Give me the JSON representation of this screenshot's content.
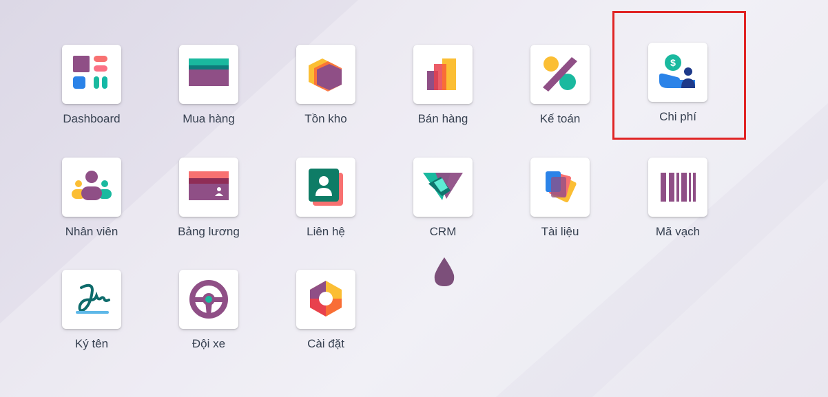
{
  "apps": [
    {
      "key": "dashboard",
      "label": "Dashboard",
      "icon": "dashboard-icon"
    },
    {
      "key": "purchase",
      "label": "Mua hàng",
      "icon": "purchase-card-icon"
    },
    {
      "key": "inventory",
      "label": "Tồn kho",
      "icon": "inventory-box-icon"
    },
    {
      "key": "sales",
      "label": "Bán hàng",
      "icon": "sales-chart-icon"
    },
    {
      "key": "accounting",
      "label": "Kế toán",
      "icon": "accounting-percent-icon"
    },
    {
      "key": "expenses",
      "label": "Chi phí",
      "icon": "expenses-icon"
    },
    {
      "key": "employees",
      "label": "Nhân viên",
      "icon": "employees-icon"
    },
    {
      "key": "payroll",
      "label": "Bảng lương",
      "icon": "payroll-card-icon"
    },
    {
      "key": "contacts",
      "label": "Liên hệ",
      "icon": "contacts-icon"
    },
    {
      "key": "crm",
      "label": "CRM",
      "icon": "crm-handshake-icon"
    },
    {
      "key": "documents",
      "label": "Tài liệu",
      "icon": "documents-icon"
    },
    {
      "key": "barcode",
      "label": "Mã vạch",
      "icon": "barcode-icon"
    },
    {
      "key": "sign",
      "label": "Ký tên",
      "icon": "signature-icon"
    },
    {
      "key": "fleet",
      "label": "Đội xe",
      "icon": "steering-wheel-icon"
    },
    {
      "key": "settings",
      "label": "Cài đặt",
      "icon": "settings-gear-icon"
    }
  ],
  "highlighted_app": "expenses",
  "colors": {
    "highlight": "#e02424",
    "brand_purple": "#8f4f86",
    "teal": "#1ab99f",
    "orange": "#f96e36",
    "yellow": "#fbbe34"
  }
}
